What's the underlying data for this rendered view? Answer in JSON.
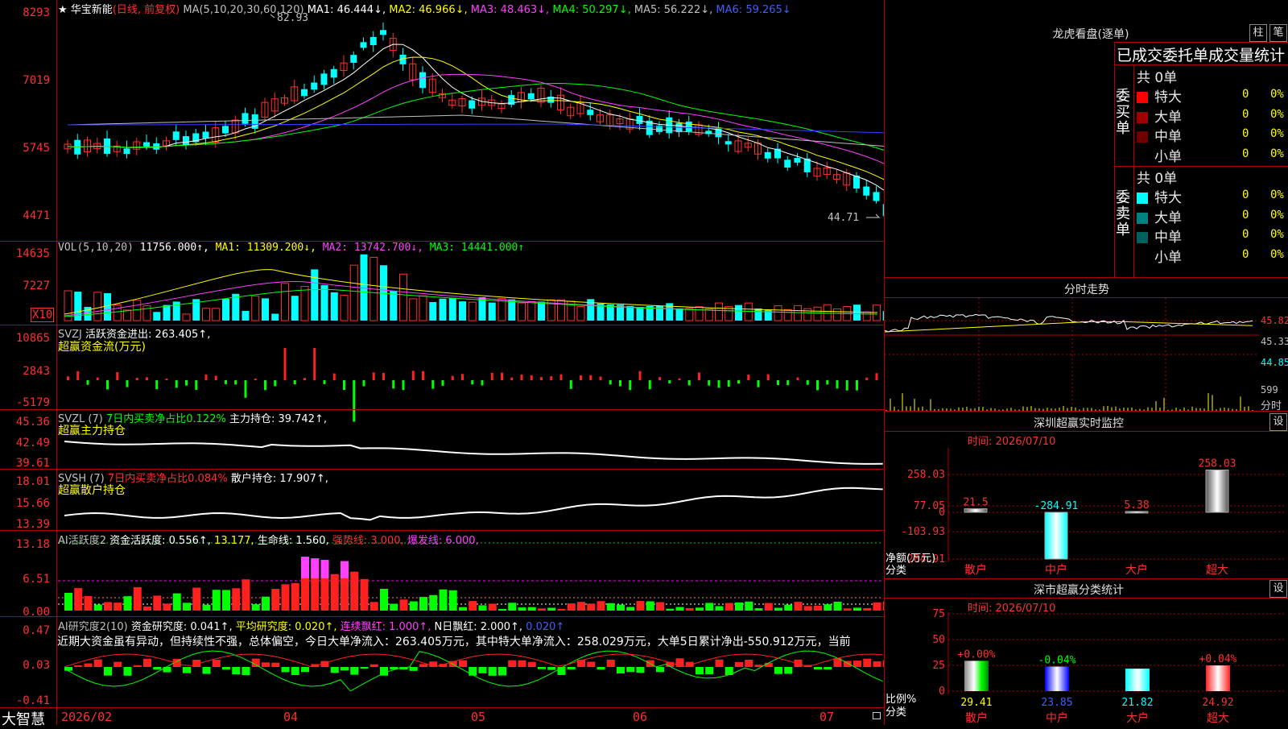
{
  "stock": {
    "star": "★",
    "name": "华宝新能",
    "mode": "(日线, 前复权)",
    "ma_params": "MA(5,10,20,30,60,120)",
    "ma1": "MA1: 46.444↓,",
    "ma2": "MA2: 46.966↓,",
    "ma3": "MA3: 48.463↓,",
    "ma4": "MA4: 50.297↓,",
    "ma5": "MA5: 56.222↓,",
    "ma6": "MA6: 59.265↓",
    "high_mark": "82.93",
    "low_mark": "44.71"
  },
  "price_axis": [
    "8293",
    "7019",
    "5745",
    "4471"
  ],
  "vol": {
    "head": "VOL(5,10,20)",
    "value": "11756.000↑,",
    "ma1": "MA1: 11309.200↓,",
    "ma2": "MA2: 13742.700↓,",
    "ma3": "MA3: 14441.000↑",
    "axis": [
      "14635",
      "7227"
    ],
    "unit": "X10"
  },
  "svzj": {
    "head": "SVZJ",
    "label": "活跃资金进出: 263.405↑,",
    "sub": "超赢资金流(万元)",
    "axis": [
      "10865",
      "2843",
      "-5179"
    ]
  },
  "svzl": {
    "head": "SVZL (7)",
    "green": "7日内买卖净占比0.122%",
    "label": "主力持仓: 39.742↑,",
    "sub": "超赢主力持仓",
    "axis": [
      "45.36",
      "42.49",
      "39.61"
    ]
  },
  "svsh": {
    "head": "SVSH (7)",
    "red": "7日内买卖净占比0.084%",
    "label": "散户持仓: 17.907↑,",
    "sub": "超赢散户持仓",
    "axis": [
      "18.01",
      "15.66",
      "13.39"
    ]
  },
  "ai1": {
    "head": "AI活跃度2",
    "a": "资金活跃度: 0.556↑,",
    "b": "13.177,",
    "c": "生命线: 1.560,",
    "d": "强势线: 3.000,",
    "e": "爆发线: 6.000,",
    "axis": [
      "13.18",
      "6.51",
      "0.00"
    ]
  },
  "ai2": {
    "head": "AI研究度2(10)",
    "a": "资金研究度: 0.041↑,",
    "b": "平均研究度: 0.020↑,",
    "c": "连续飘红: 1.000↑,",
    "d": "N日飘红: 2.000↑,",
    "e": "0.020↑",
    "note": "近期大资金虽有异动，但持续性不强，总体偏空，今日大单净流入：263.405万元，其中特大单净流入：258.029万元，大单5日累计净出-550.912万元，当前",
    "axis": [
      "0.47",
      "0.03",
      "-0.41"
    ]
  },
  "bottom": {
    "brand": "大智慧",
    "dates": [
      "2026/02",
      "04",
      "05",
      "06",
      "07"
    ]
  },
  "lhb": {
    "title": "龙虎看盘(逐单)",
    "btn1": "柱",
    "btn2": "笔",
    "tab": "已成交委托单成交量统计",
    "buy_side": "委买单",
    "sell_side": "委卖单",
    "buy_total": "共 0单",
    "sell_total": "共 0单",
    "rows": [
      {
        "label": "特大",
        "count": "0",
        "pct": "0%"
      },
      {
        "label": "大单",
        "count": "0",
        "pct": "0%"
      },
      {
        "label": "中单",
        "count": "0",
        "pct": "0%"
      },
      {
        "label": "小单",
        "count": "0",
        "pct": "0%"
      }
    ],
    "buy_colors": [
      "#ff0000",
      "#a00000",
      "#700000",
      "#000000"
    ],
    "sell_colors": [
      "#00ffff",
      "#008080",
      "#006060",
      "#000000"
    ]
  },
  "minute": {
    "title": "分时走势",
    "prices": [
      "45.82",
      "45.33",
      "44.85"
    ],
    "vol": "599",
    "vol_label": "分时"
  },
  "sz_monitor": {
    "title": "深圳超赢实时监控",
    "set": "设",
    "time": "时间: 2026/07/10",
    "axis": [
      "258.03",
      "77.05",
      "0",
      "-103.93",
      "-284.91"
    ],
    "ylabel": "净额(万元)",
    "xlabel": "分类",
    "values": [
      "21.5",
      "-284.91",
      "5.38",
      "258.03"
    ],
    "cats": [
      "散户",
      "中户",
      "大户",
      "超大"
    ]
  },
  "sz_class": {
    "title": "深市超赢分类统计",
    "set": "设",
    "time": "时间: 2026/07/10",
    "axis": [
      "75",
      "50",
      "25",
      "0"
    ],
    "ylabel": "比例%",
    "xlabel": "分类",
    "changes": [
      "+0.00%",
      "-0.04%",
      "",
      "+0.04%"
    ],
    "values": [
      "29.41",
      "23.85",
      "21.82",
      "24.92"
    ],
    "cats": [
      "散户",
      "中户",
      "大户",
      "超大"
    ]
  }
}
